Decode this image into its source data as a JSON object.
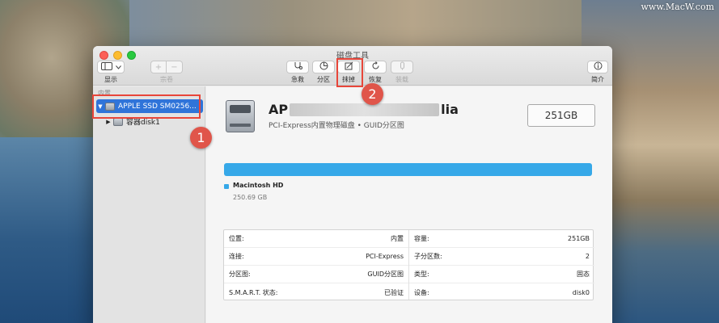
{
  "watermark": "www.MacW.com",
  "window_title": "磁盘工具",
  "toolbar": {
    "view_label": "显示",
    "add_label": "+",
    "remove_label": "−",
    "volume_label": "宗卷",
    "rescue_label": "急救",
    "partition_label": "分区",
    "erase_label": "抹掉",
    "restore_label": "恢复",
    "mount_label": "装载",
    "info_label": "简介",
    "icons": [
      "sidebar-icon",
      "chevron-down-icon",
      "stethoscope-icon",
      "pie-icon",
      "erase-icon",
      "restore-icon",
      "eject-icon",
      "info-icon"
    ]
  },
  "annotations": {
    "step1": "1",
    "step2": "2",
    "color": "#e8463a"
  },
  "sidebar": {
    "heading": "内置",
    "items": [
      {
        "label": "APPLE SSD SM0256..."
      },
      {
        "label": "容器disk1"
      }
    ]
  },
  "disk": {
    "name_prefix": "AP",
    "name_suffix": "lia",
    "subtitle": "PCI-Express内置物理磁盘 • GUID分区图",
    "capacity": "251GB"
  },
  "volume": {
    "name": "Macintosh HD",
    "size": "250.69 GB",
    "color": "#36a8e8"
  },
  "info": {
    "left": [
      {
        "key": "位置:",
        "value": "内置"
      },
      {
        "key": "连接:",
        "value": "PCI-Express"
      },
      {
        "key": "分区图:",
        "value": "GUID分区图"
      },
      {
        "key": "S.M.A.R.T. 状态:",
        "value": "已验证"
      }
    ],
    "right": [
      {
        "key": "容量:",
        "value": "251GB"
      },
      {
        "key": "子分区数:",
        "value": "2"
      },
      {
        "key": "类型:",
        "value": "固态"
      },
      {
        "key": "设备:",
        "value": "disk0"
      }
    ]
  }
}
